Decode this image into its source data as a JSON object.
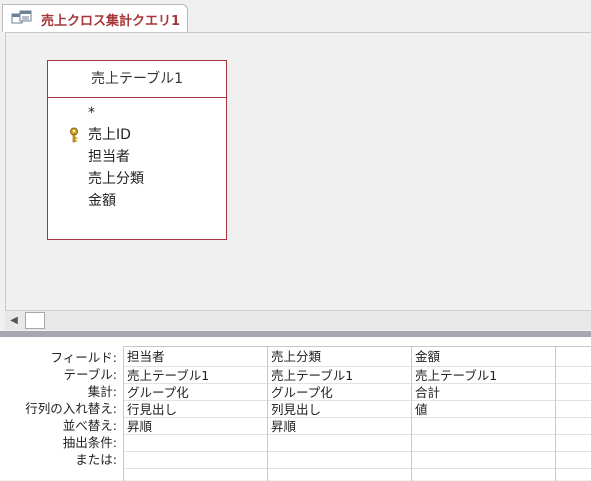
{
  "tab": {
    "title": "売上クロス集計クエリ1",
    "icon": "query-icon",
    "accent": "#a4373a"
  },
  "table": {
    "name": "売上テーブル1",
    "fields": [
      {
        "name": "*",
        "key": false
      },
      {
        "name": "売上ID",
        "key": true
      },
      {
        "name": "担当者",
        "key": false
      },
      {
        "name": "売上分類",
        "key": false
      },
      {
        "name": "金額",
        "key": false
      }
    ]
  },
  "grid": {
    "row_labels": [
      "フィールド:",
      "テーブル:",
      "集計:",
      "行列の入れ替え:",
      "並べ替え:",
      "抽出条件:",
      "または:"
    ],
    "columns": [
      {
        "field": "担当者",
        "table": "売上テーブル1",
        "total": "グループ化",
        "crosstab": "行見出し",
        "sort": "昇順",
        "criteria": "",
        "or": ""
      },
      {
        "field": "売上分類",
        "table": "売上テーブル1",
        "total": "グループ化",
        "crosstab": "列見出し",
        "sort": "昇順",
        "criteria": "",
        "or": ""
      },
      {
        "field": "金額",
        "table": "売上テーブル1",
        "total": "合計",
        "crosstab": "値",
        "sort": "",
        "criteria": "",
        "or": ""
      },
      {
        "field": "",
        "table": "",
        "total": "",
        "crosstab": "",
        "sort": "",
        "criteria": "",
        "or": ""
      }
    ]
  }
}
